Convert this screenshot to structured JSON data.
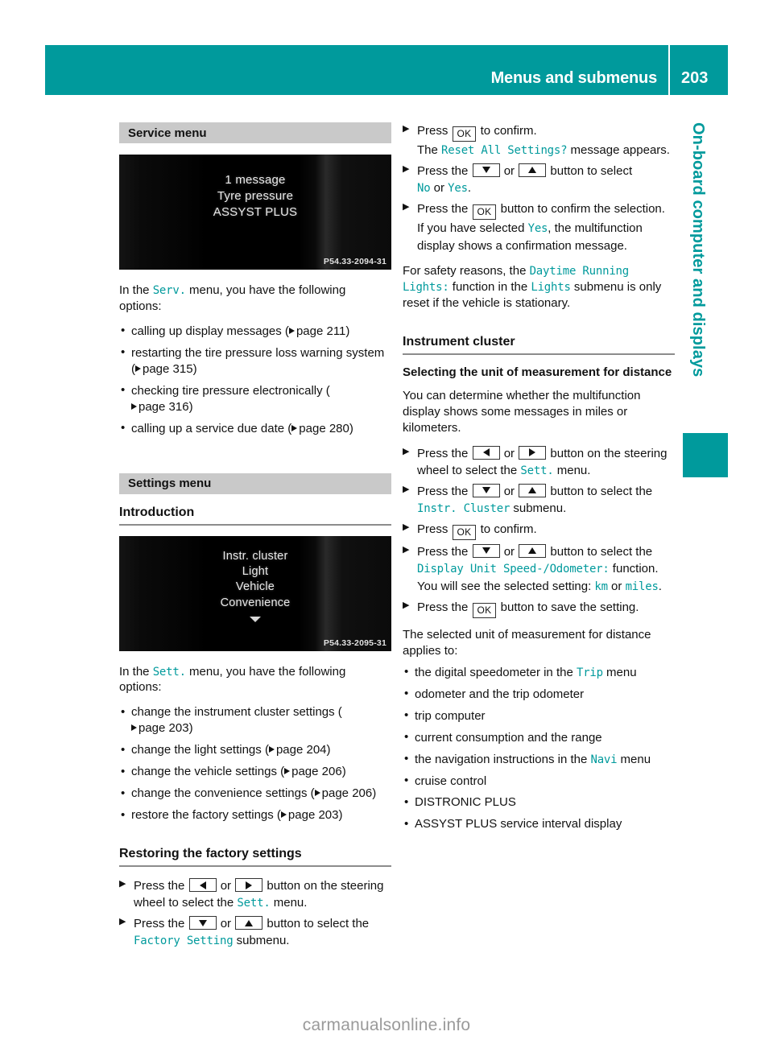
{
  "header": {
    "title": "Menus and submenus",
    "page_number": "203"
  },
  "side_tab": {
    "label": "On-board computer and displays"
  },
  "left_column": {
    "service_section": {
      "banner": "Service menu",
      "figure": {
        "lines": [
          "1 message",
          "Tyre pressure",
          "ASSYST PLUS"
        ],
        "code": "P54.33-2094-31"
      },
      "intro_pre": "In the ",
      "intro_menu": "Serv.",
      "intro_post": " menu, you have the following options:",
      "bullets": [
        {
          "text": "calling up display messages (",
          "ref": "page 211",
          "tail": ")"
        },
        {
          "text": "restarting the tire pressure loss warning system (",
          "ref": "page 315",
          "tail": ")"
        },
        {
          "text": "checking tire pressure electronically (",
          "ref": "page 316",
          "tail": ")"
        },
        {
          "text": "calling up a service due date (",
          "ref": "page 280",
          "tail": ")"
        }
      ]
    },
    "settings_section": {
      "banner": "Settings menu",
      "heading": "Introduction",
      "figure": {
        "lines": [
          "Instr. cluster",
          "Light",
          "Vehicle",
          "Convenience"
        ],
        "code": "P54.33-2095-31"
      },
      "intro_pre": "In the ",
      "intro_menu": "Sett.",
      "intro_post": " menu, you have the following options:",
      "bullets": [
        {
          "text": "change the instrument cluster settings (",
          "ref": "page 203",
          "tail": ")"
        },
        {
          "text": "change the light settings (",
          "ref": "page 204",
          "tail": ")"
        },
        {
          "text": "change the vehicle settings (",
          "ref": "page 206",
          "tail": ")"
        },
        {
          "text": "change the convenience settings (",
          "ref": "page 206",
          "tail": ")"
        },
        {
          "text": "restore the factory settings (",
          "ref": "page 203",
          "tail": ")"
        }
      ]
    },
    "factory_section": {
      "heading": "Restoring the factory settings",
      "step1_a": "Press the ",
      "step1_b": " or ",
      "step1_c": " button on the steering wheel to select the ",
      "step1_menu": "Sett.",
      "step1_d": " menu.",
      "step2_a": "Press the ",
      "step2_b": " or ",
      "step2_c": " button to select the ",
      "step2_menu": "Factory Setting",
      "step2_d": " submenu."
    }
  },
  "right_column": {
    "continued_steps": {
      "s1_a": "Press ",
      "s1_b": " to confirm.",
      "s1_sub_pre": "The ",
      "s1_sub_mono": "Reset All Settings?",
      "s1_sub_post": " message appears.",
      "s2_a": "Press the ",
      "s2_b": " or ",
      "s2_c": " button to select ",
      "s2_no": "No",
      "s2_or": " or ",
      "s2_yes": "Yes",
      "s2_end": ".",
      "s3_a": "Press the ",
      "s3_b": " button to confirm the selection.",
      "s3_sub_pre": "If you have selected ",
      "s3_sub_yes": "Yes",
      "s3_sub_post": ", the multifunction display shows a confirmation message."
    },
    "safety_note": {
      "pre": "For safety reasons, the ",
      "mono1": "Daytime Running Lights:",
      "mid": " function in the ",
      "mono2": "Lights",
      "post": " submenu is only reset if the vehicle is stationary."
    },
    "instrument_cluster": {
      "heading": "Instrument cluster",
      "subheading": "Selecting the unit of measurement for distance",
      "intro": "You can determine whether the multifunction display shows some messages in miles or kilometers.",
      "t1_a": "Press the ",
      "t1_b": " or ",
      "t1_c": " button on the steering wheel to select the ",
      "t1_menu": "Sett.",
      "t1_d": " menu.",
      "t2_a": "Press the ",
      "t2_b": " or ",
      "t2_c": " button to select the ",
      "t2_menu": "Instr. Cluster",
      "t2_d": " submenu.",
      "t3_a": "Press ",
      "t3_b": " to confirm.",
      "t4_a": "Press the ",
      "t4_b": " or ",
      "t4_c": " button to select the ",
      "t4_menu": "Display Unit Speed-/Odometer:",
      "t4_d": " function.",
      "t4_sub_pre": "You will see the selected setting: ",
      "t4_sub_km": "km",
      "t4_sub_or": " or ",
      "t4_sub_miles": "miles",
      "t4_sub_end": ".",
      "t5_a": "Press the ",
      "t5_b": " button to save the setting."
    },
    "applies_intro": "The selected unit of measurement for distance applies to:",
    "applies_bullets": [
      {
        "pre": "the digital speedometer in the ",
        "mono": "Trip",
        "post": " menu"
      },
      {
        "pre": "odometer and the trip odometer",
        "mono": "",
        "post": ""
      },
      {
        "pre": "trip computer",
        "mono": "",
        "post": ""
      },
      {
        "pre": "current consumption and the range",
        "mono": "",
        "post": ""
      },
      {
        "pre": "the navigation instructions in the ",
        "mono": "Navi",
        "post": " menu"
      },
      {
        "pre": "cruise control",
        "mono": "",
        "post": ""
      },
      {
        "pre": "DISTRONIC PLUS",
        "mono": "",
        "post": ""
      },
      {
        "pre": "ASSYST PLUS service interval display",
        "mono": "",
        "post": ""
      }
    ]
  },
  "watermark": "carmanualsonline.info",
  "colors": {
    "accent_teal": "#009A9C",
    "banner_gray": "#C9C9C9",
    "rule_gray": "#8C8C8C"
  }
}
